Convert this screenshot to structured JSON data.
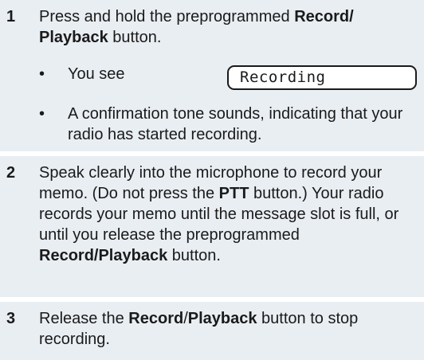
{
  "steps": [
    {
      "number": "1",
      "text_parts": [
        "Press and hold the preprogrammed ",
        "Record/ Playback",
        " button."
      ],
      "bullets": [
        {
          "text": "You see",
          "display": "Recording"
        },
        {
          "text": "A confirmation tone sounds, indicating that your radio has started recording."
        }
      ]
    },
    {
      "number": "2",
      "text_parts": [
        "Speak clearly into the microphone to record your memo. (Do not press the ",
        "PTT",
        " button.) Your radio records your memo until the message slot is full, or until you release the preprogrammed ",
        "Record/Playback",
        " button."
      ]
    },
    {
      "number": "3",
      "text_parts": [
        "Release the ",
        "Record",
        "/",
        "Playback",
        " button to stop recording."
      ]
    }
  ],
  "bullet_symbol": "•",
  "colors": {
    "step_background": "#e9eef3",
    "text": "#1a1a1a"
  }
}
